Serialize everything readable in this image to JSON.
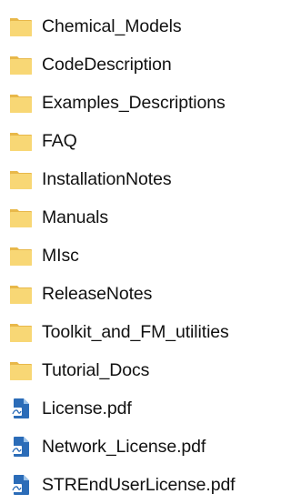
{
  "items": [
    {
      "label": "Chemical_Models",
      "icon": "folder-icon",
      "kind": "folder"
    },
    {
      "label": "CodeDescription",
      "icon": "folder-icon",
      "kind": "folder"
    },
    {
      "label": "Examples_Descriptions",
      "icon": "folder-icon",
      "kind": "folder"
    },
    {
      "label": "FAQ",
      "icon": "folder-icon",
      "kind": "folder"
    },
    {
      "label": "InstallationNotes",
      "icon": "folder-icon",
      "kind": "folder"
    },
    {
      "label": "Manuals",
      "icon": "folder-icon",
      "kind": "folder"
    },
    {
      "label": "MIsc",
      "icon": "folder-icon",
      "kind": "folder"
    },
    {
      "label": "ReleaseNotes",
      "icon": "folder-icon",
      "kind": "folder"
    },
    {
      "label": "Toolkit_and_FM_utilities",
      "icon": "folder-icon",
      "kind": "folder"
    },
    {
      "label": "Tutorial_Docs",
      "icon": "folder-icon",
      "kind": "folder"
    },
    {
      "label": "License.pdf",
      "icon": "pdf-file-icon",
      "kind": "file"
    },
    {
      "label": "Network_License.pdf",
      "icon": "pdf-file-icon",
      "kind": "file"
    },
    {
      "label": "STREndUserLicense.pdf",
      "icon": "pdf-file-icon",
      "kind": "file"
    }
  ],
  "colors": {
    "folder_body": "#F8D775",
    "folder_back": "#E8B84A",
    "pdf_page": "#2B6CB8",
    "pdf_fold": "#9CC3EA",
    "text": "#111111"
  }
}
